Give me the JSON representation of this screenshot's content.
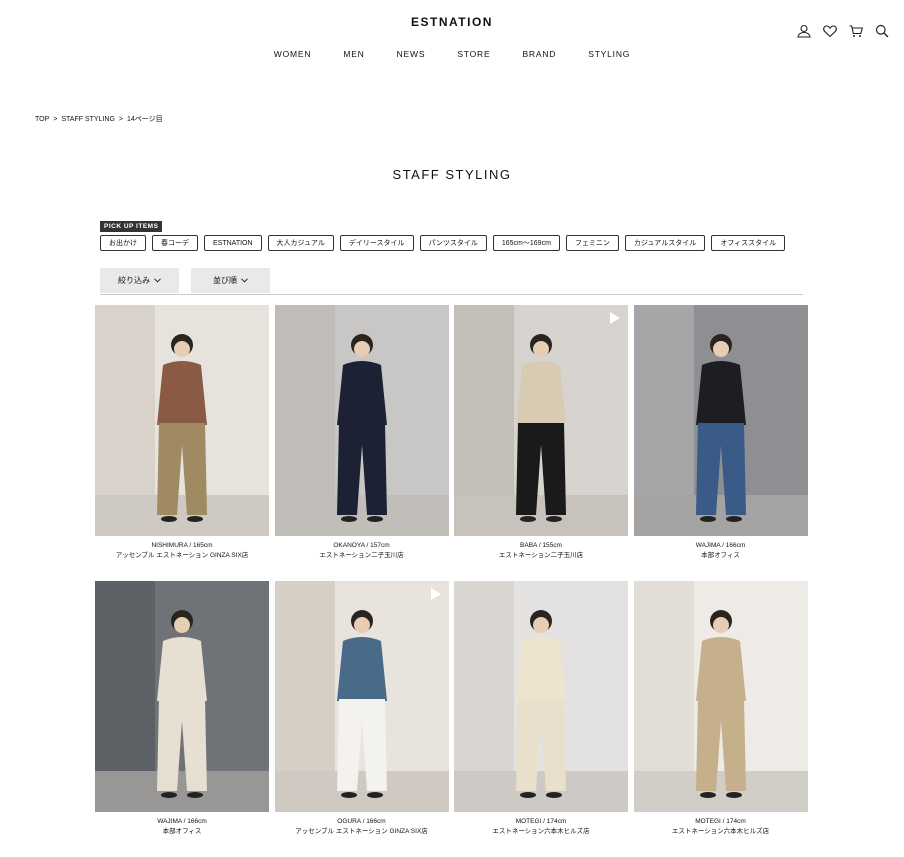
{
  "header": {
    "logo": "ESTNATION",
    "nav": [
      "WOMEN",
      "MEN",
      "NEWS",
      "STORE",
      "BRAND",
      "STYLING"
    ],
    "icons": [
      "user-icon",
      "heart-icon",
      "cart-icon",
      "search-icon"
    ]
  },
  "breadcrumb": [
    "TOP",
    "STAFF STYLING",
    "14ページ目"
  ],
  "page_title": "STAFF STYLING",
  "pickup": {
    "label": "PICK UP ITEMS",
    "tags": [
      "お出かけ",
      "春コーデ",
      "ESTNATION",
      "大人カジュアル",
      "デイリースタイル",
      "パンツスタイル",
      "165cm〜169cm",
      "フェミニン",
      "カジュアルスタイル",
      "オフィススタイル"
    ]
  },
  "filters": {
    "refine_label": "絞り込み",
    "sort_label": "並び順"
  },
  "colors": {
    "accent": "#333333",
    "filter_bg": "#e9e9e9"
  },
  "items": [
    {
      "name": "NISHIMURA / 165cm",
      "store": "アッセンブル エストネーション GINZA SIX店",
      "video": false,
      "bg": "#e6e2dc",
      "wall": "#d8d2ca",
      "top": "#8a5a44",
      "bottom": "#a08a62"
    },
    {
      "name": "OKANOYA / 157cm",
      "store": "エストネーション二子玉川店",
      "video": false,
      "bg": "#c9c7c5",
      "wall": "#bfbcb9",
      "top": "#1c2233",
      "bottom": "#1c2233"
    },
    {
      "name": "BABA / 155cm",
      "store": "エストネーション二子玉川店",
      "video": true,
      "bg": "#d7d3cf",
      "wall": "#c3beb8",
      "top": "#d8cbb3",
      "bottom": "#1a1a1a"
    },
    {
      "name": "WAJIMA / 166cm",
      "store": "本部オフィス",
      "video": false,
      "bg": "#8d8f92",
      "wall": "#a5a6a8",
      "top": "#1e1e22",
      "bottom": "#3a5a88"
    },
    {
      "name": "WAJIMA / 166cm",
      "store": "本部オフィス",
      "video": false,
      "bg": "#6f7378",
      "wall": "#5d6166",
      "top": "#e6dfd2",
      "bottom": "#e6dfd2"
    },
    {
      "name": "OGURA / 166cm",
      "store": "アッセンブル エストネーション GINZA SIX店",
      "video": true,
      "bg": "#e8e3dc",
      "wall": "#d6cfc6",
      "top": "#4a6a8a",
      "bottom": "#f4f2ee"
    },
    {
      "name": "MOTEGI / 174cm",
      "store": "エストネーション六本木ヒルズ店",
      "video": false,
      "bg": "#e4e2e0",
      "wall": "#d9d6d2",
      "top": "#ece4cc",
      "bottom": "#e8e0cc"
    },
    {
      "name": "MOTEGI / 174cm",
      "store": "エストネーション六本木ヒルズ店",
      "video": false,
      "bg": "#eeeae6",
      "wall": "#e2ddd7",
      "top": "#c6b08c",
      "bottom": "#c6b08c"
    }
  ]
}
